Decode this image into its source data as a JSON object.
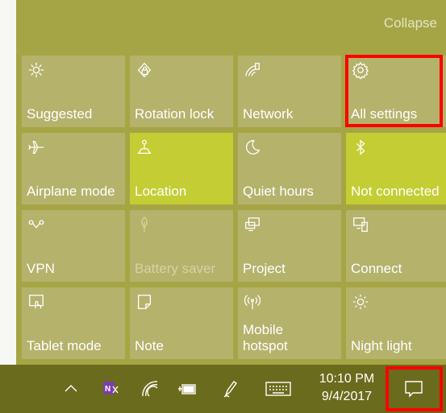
{
  "action_center": {
    "collapse_label": "Collapse",
    "tiles": [
      {
        "label": "Suggested",
        "icon": "sun-icon",
        "active": false
      },
      {
        "label": "Rotation lock",
        "icon": "rotation-lock-icon",
        "active": false
      },
      {
        "label": "Network",
        "icon": "network-icon",
        "active": false
      },
      {
        "label": "All settings",
        "icon": "gear-icon",
        "active": false
      },
      {
        "label": "Airplane mode",
        "icon": "airplane-icon",
        "active": false
      },
      {
        "label": "Location",
        "icon": "location-icon",
        "active": true
      },
      {
        "label": "Quiet hours",
        "icon": "moon-icon",
        "active": false
      },
      {
        "label": "Not connected",
        "icon": "bluetooth-icon",
        "active": true
      },
      {
        "label": "VPN",
        "icon": "vpn-icon",
        "active": false
      },
      {
        "label": "Battery saver",
        "icon": "battery-saver-icon",
        "active": false,
        "disabled": true
      },
      {
        "label": "Project",
        "icon": "project-icon",
        "active": false
      },
      {
        "label": "Connect",
        "icon": "connect-icon",
        "active": false
      },
      {
        "label": "Tablet mode",
        "icon": "tablet-mode-icon",
        "active": false
      },
      {
        "label": "Note",
        "icon": "note-icon",
        "active": false
      },
      {
        "label": "Mobile\nhotspot",
        "icon": "hotspot-icon",
        "active": false
      },
      {
        "label": "Night light",
        "icon": "night-light-icon",
        "active": false
      }
    ]
  },
  "taskbar": {
    "icons": [
      "chevron-up-icon",
      "onenote-icon",
      "wifi-icon",
      "power-icon",
      "pen-icon",
      "keyboard-icon"
    ],
    "time": "10:10 PM",
    "date": "9/4/2017",
    "notification_icon": "action-center-icon"
  },
  "colors": {
    "panel": "#a6a545",
    "tile": "#b5b26c",
    "tile_active": "#c4cd33",
    "taskbar": "#6b6b1d",
    "highlight": "#ff0000"
  }
}
